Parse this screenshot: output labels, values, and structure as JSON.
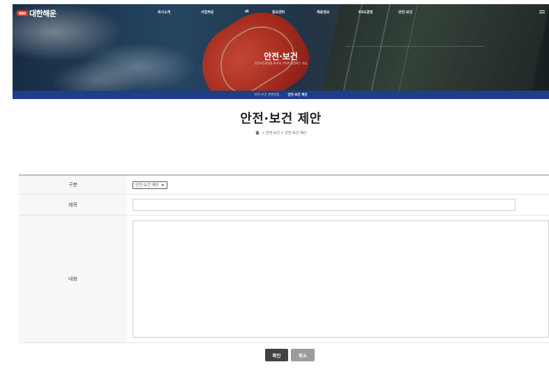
{
  "header": {
    "logo_text": "대한해운",
    "nav_items": [
      "회사소개",
      "사업부문",
      "IR",
      "홍보센터",
      "채용정보",
      "ESG경영",
      "안전·보건"
    ],
    "hero_title": "안전·보건",
    "hero_subtitle": "안전보건경영을 최고의 가치로 실천하는 기업"
  },
  "subnav": {
    "items": [
      "안전·보건 경영방침",
      "안전·보건 제안"
    ],
    "active_index": 1
  },
  "page": {
    "title": "안전·보건 제안",
    "breadcrumb": [
      "안전·보건",
      "안전·보건 제안"
    ],
    "breadcrumb_separator": ">"
  },
  "form": {
    "category_label": "구분",
    "category_selected": "안전·보건 제안",
    "title_label": "제목",
    "title_value": "",
    "content_label": "내용",
    "content_value": ""
  },
  "buttons": {
    "confirm_label": "확인",
    "cancel_label": "취소"
  },
  "colors": {
    "subnav_bg": "#1e3f86",
    "logo_accent": "#e8341c",
    "confirm_bg": "#424242",
    "cancel_bg": "#9b9b9b"
  },
  "icons": [
    "menu-icon",
    "home-icon",
    "chevron-down-icon"
  ]
}
